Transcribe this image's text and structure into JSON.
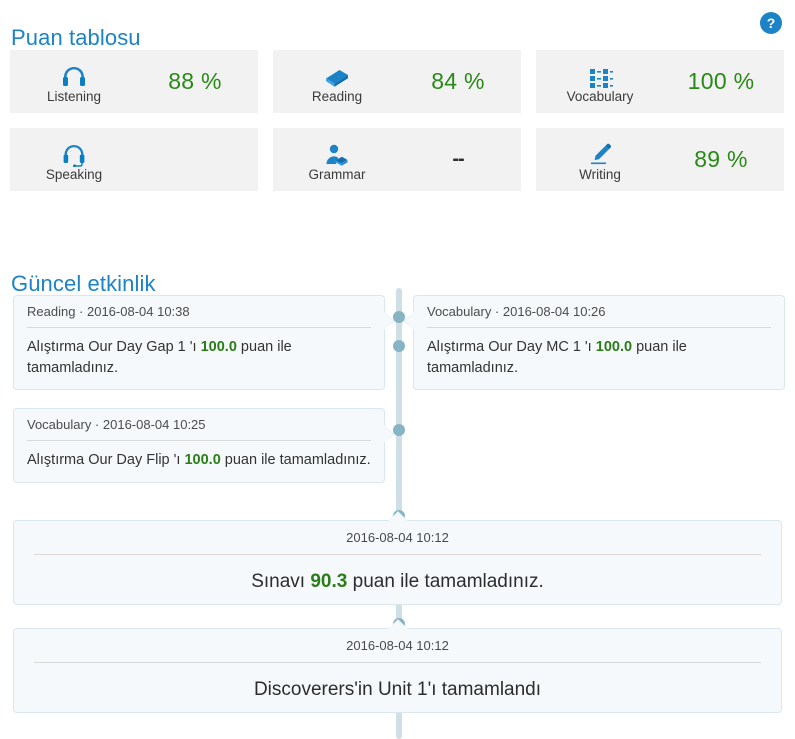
{
  "scorecard": {
    "title": "Puan tablosu",
    "help_label": "?",
    "items": [
      {
        "icon": "headphones-icon",
        "label": "Listening",
        "value": "88 %",
        "has_value": true
      },
      {
        "icon": "book-icon",
        "label": "Reading",
        "value": "84 %",
        "has_value": true
      },
      {
        "icon": "grid-list-icon",
        "label": "Vocabulary",
        "value": "100 %",
        "has_value": true
      },
      {
        "icon": "headset-icon",
        "label": "Speaking",
        "value": "",
        "has_value": false
      },
      {
        "icon": "person-book-icon",
        "label": "Grammar",
        "value": "--",
        "has_value": false
      },
      {
        "icon": "pencil-icon",
        "label": "Writing",
        "value": "89 %",
        "has_value": true
      }
    ]
  },
  "activity": {
    "title": "Güncel etkinlik",
    "events": [
      {
        "side": "left",
        "header": "Reading · 2016-08-04 10:38",
        "text_before": "Alıştırma Our Day Gap 1 'ı ",
        "score": "100.0",
        "text_after": " puan ile tamamladınız."
      },
      {
        "side": "right",
        "header": "Vocabulary · 2016-08-04 10:26",
        "text_before": "Alıştırma Our Day MC 1 'ı ",
        "score": "100.0",
        "text_after": " puan ile tamamladınız."
      },
      {
        "side": "left",
        "header": "Vocabulary · 2016-08-04 10:25",
        "text_before": "Alıştırma Our Day Flip 'ı ",
        "score": "100.0",
        "text_after": " puan ile tamamladınız."
      },
      {
        "side": "wide",
        "header": "2016-08-04 10:12",
        "text_before": "Sınavı ",
        "score": "90.3",
        "text_after": " puan ile tamamladınız."
      },
      {
        "side": "wide",
        "header": "2016-08-04 10:12",
        "text_before": "Discoverers'in Unit 1'ı tamamlandı",
        "score": "",
        "text_after": ""
      }
    ]
  },
  "colors": {
    "heading_blue": "#1c83c6",
    "score_green": "#2a8a17",
    "icon_blue": "#1c83c6",
    "card_bg": "#f2f2f2",
    "timeline_bg": "#f5f9fb",
    "timeline_axis": "#cfdfe6",
    "timeline_dot": "#86b4c4"
  }
}
